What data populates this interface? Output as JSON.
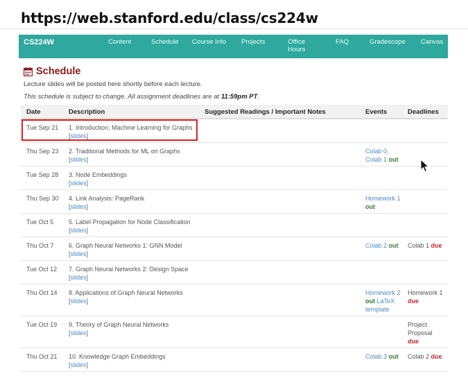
{
  "url_banner": "https://web.stanford.edu/class/cs224w",
  "nav": {
    "brand": "CS224W",
    "items": [
      "Content",
      "Schedule",
      "Course Info",
      "Projects",
      "Office\nHours",
      "FAQ",
      "Gradescope",
      "Canvas"
    ],
    "bg_color": "#2fa89e"
  },
  "section": {
    "icon": "calendar-icon",
    "title": "Schedule",
    "note": "Lecture slides will be posted here shortly before each lecture.",
    "change_note_prefix": "This schedule is subject to change. All assignment deadlines are at ",
    "change_note_time": "11:59pm PT",
    "change_note_suffix": "."
  },
  "table": {
    "headers": [
      "Date",
      "Description",
      "Suggested Readings / Important Notes",
      "Events",
      "Deadlines"
    ],
    "slides_label": "slides",
    "rows": [
      {
        "date": "Tue Sep 21",
        "desc": "1. Introduction; Machine Learning for Graphs"
      },
      {
        "date": "Thu Sep 23",
        "desc": "2. Traditional Methods for ML on Graphs"
      },
      {
        "date": "Tue Sep 28",
        "desc": "3. Node Embeddings"
      },
      {
        "date": "Thu Sep 30",
        "desc": "4. Link Analysis: PageRank"
      },
      {
        "date": "Tue Oct 5",
        "desc": "5. Label Propagation for Node Classification"
      },
      {
        "date": "Thu Oct 7",
        "desc": "6. Graph Neural Networks 1: GNN Model"
      },
      {
        "date": "Tue Oct 12",
        "desc": "7. Graph Neural Networks 2: Design Space"
      },
      {
        "date": "Thu Oct 14",
        "desc": "8. Applications of Graph Neural Networks"
      },
      {
        "date": "Tue Oct 19",
        "desc": "9. Theory of Graph Neural Networks"
      },
      {
        "date": "Thu Oct 21",
        "desc": "10. Knowledge Graph Embeddings"
      }
    ],
    "events": {
      "r2_colab0": "Colab 0",
      "r2_comma": ",",
      "r2_colab1": "Colab 1",
      "r4_hw1": "Homework 1",
      "r6_colab2": "Colab 2",
      "r8_hw2": "Homework 2",
      "r8_latex": "LaTeX",
      "r8_template": "template",
      "r10_colab3": "Colab 3",
      "out": "out"
    },
    "deadlines": {
      "r6_colab1": "Colab 1",
      "r8_hw1": "Homework 1",
      "r9_project": "Project",
      "r9_proposal": "Proposal",
      "r10_colab2": "Colab 2",
      "due": "due"
    }
  },
  "colors": {
    "title": "#8b1c1c",
    "link": "#4a8bc2",
    "out": "#2e7d32",
    "due": "#c62828",
    "highlight": "#e02020"
  }
}
